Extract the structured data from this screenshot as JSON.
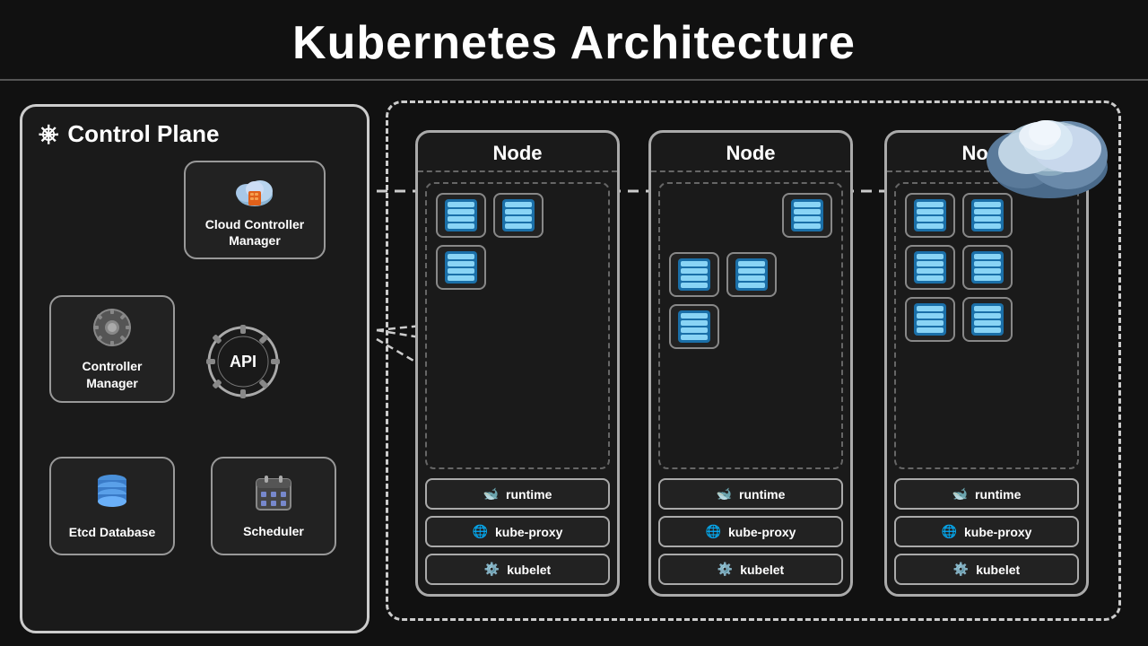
{
  "header": {
    "title": "Kubernetes Architecture"
  },
  "control_plane": {
    "label": "Control Plane",
    "components": {
      "cloud_controller_manager": {
        "label": "Cloud Controller\nManager",
        "icon": "☁️"
      },
      "controller_manager": {
        "label": "Controller\nManager",
        "icon": "⚙️"
      },
      "etcd": {
        "label": "Etcd Database",
        "icon": "🗄️"
      },
      "scheduler": {
        "label": "Scheduler",
        "icon": "📅"
      },
      "api_server": {
        "label": "API"
      }
    }
  },
  "nodes": [
    {
      "label": "Node",
      "pods": 3,
      "services": [
        "runtime",
        "kube-proxy",
        "kubelet"
      ]
    },
    {
      "label": "Node",
      "pods": 4,
      "services": [
        "runtime",
        "kube-proxy",
        "kubelet"
      ]
    },
    {
      "label": "Node",
      "pods": 6,
      "services": [
        "runtime",
        "kube-proxy",
        "kubelet"
      ]
    }
  ],
  "cloud": {
    "label": "Cloud"
  },
  "colors": {
    "background": "#111111",
    "border": "#999999",
    "accent": "#1a6fa8",
    "text": "#ffffff"
  }
}
